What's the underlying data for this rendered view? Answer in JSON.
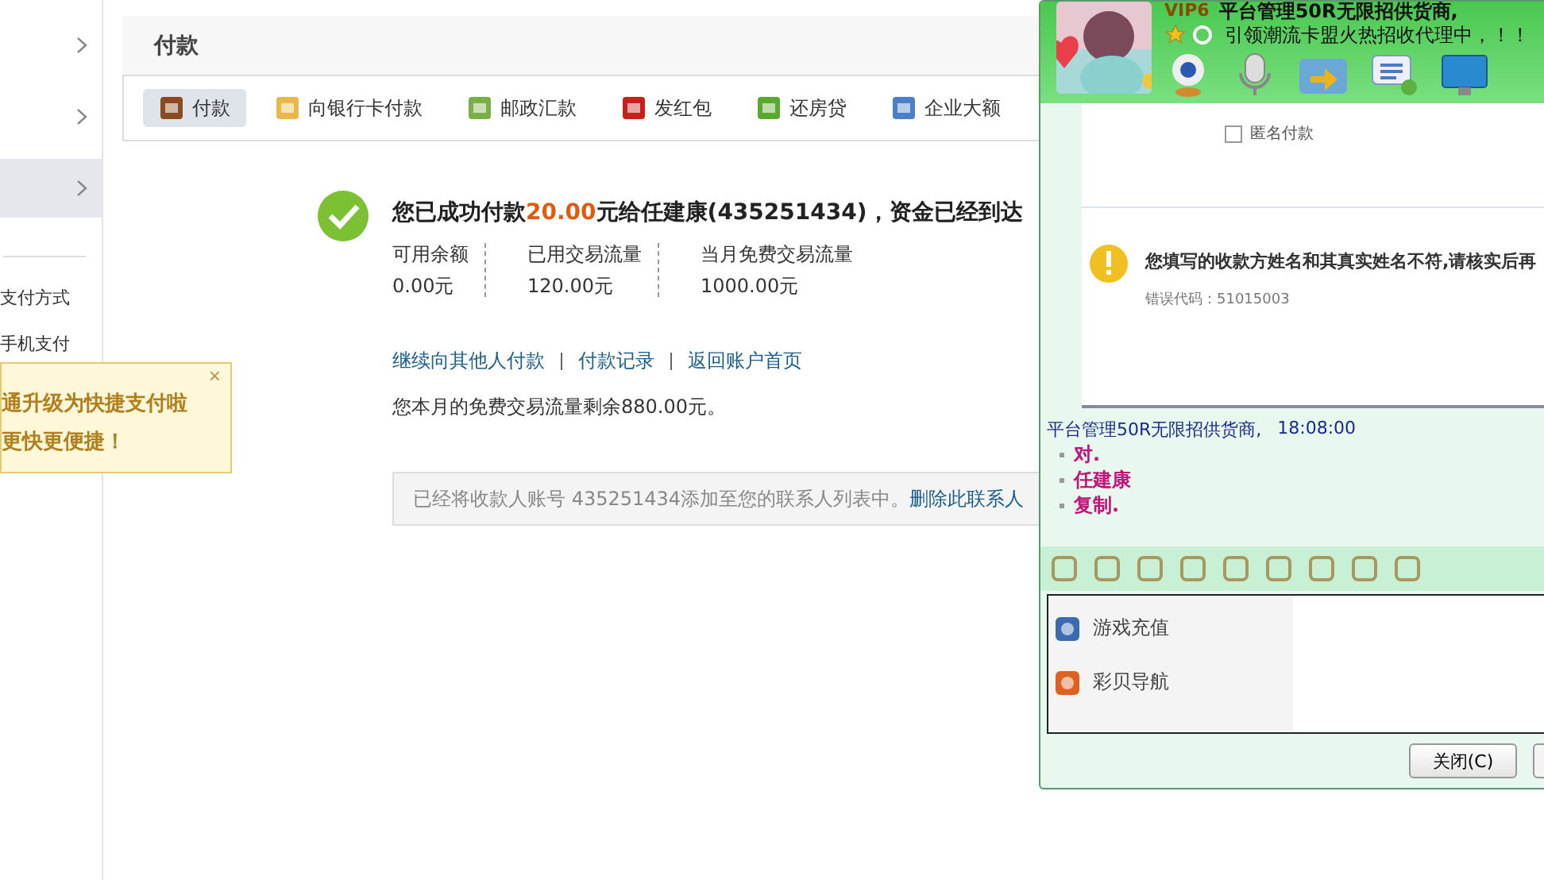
{
  "sidebar": {
    "items": [
      {
        "selected": false
      },
      {
        "selected": false
      },
      {
        "selected": true
      }
    ],
    "links": [
      "支付方式",
      "手机支付"
    ],
    "tooltip": {
      "lines": [
        "通升级为快捷支付啦",
        "更快更便捷！"
      ],
      "close": "×"
    }
  },
  "page": {
    "title": "付款",
    "tabs": [
      {
        "label": "付款",
        "selected": true
      },
      {
        "label": "向银行卡付款",
        "selected": false
      },
      {
        "label": "邮政汇款",
        "selected": false
      },
      {
        "label": "发红包",
        "selected": false
      },
      {
        "label": "还房贷",
        "selected": false
      },
      {
        "label": "企业大额",
        "selected": false
      }
    ],
    "success": {
      "before": "您已成功付款",
      "amount": "20.00",
      "after": "元给任建康(435251434)，资金已经到达"
    },
    "stats": [
      {
        "label": "可用余额",
        "value": "0.00元"
      },
      {
        "label": "已用交易流量",
        "value": "120.00元"
      },
      {
        "label": "当月免费交易流量",
        "value": "1000.00元"
      }
    ],
    "links": [
      "继续向其他人付款",
      "付款记录",
      "返回账户首页"
    ],
    "remaining": "您本月的免费交易流量剩余880.00元。",
    "notice": {
      "text": "已经将收款人账号 435251434添加至您的联系人列表中。",
      "link": "删除此联系人"
    }
  },
  "chat": {
    "vip": "VIP6",
    "name": "平台管理50R无限招供货商,",
    "signature": "引领潮流卡盟火热招收代理中，！！",
    "shared_screenshot": {
      "checkbox": {
        "label": "匿名付款",
        "checked": false
      },
      "error": "您填写的收款方姓名和其真实姓名不符,请核实后再",
      "code": "错误代码：51015003"
    },
    "message": {
      "sender": "平台管理50R无限招供货商,",
      "time": "18:08:00",
      "lines": [
        "对.",
        "任建康",
        "复制."
      ]
    },
    "apps": [
      {
        "label": "游戏充值"
      },
      {
        "label": "彩贝导航"
      }
    ],
    "buttons": [
      "关闭(C)"
    ]
  }
}
